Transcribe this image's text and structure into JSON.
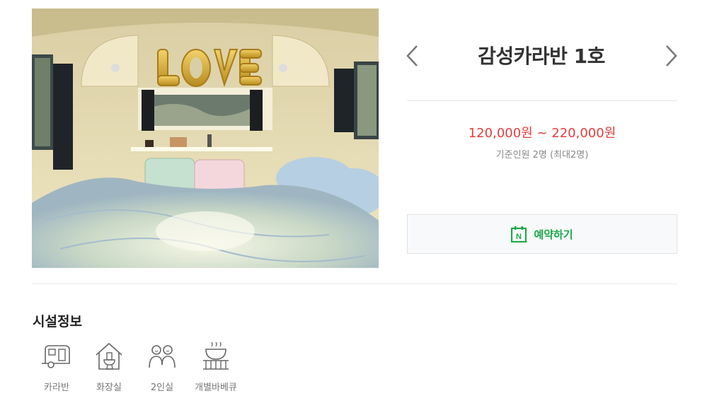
{
  "room": {
    "title": "감성카라반 1호",
    "photo_alt": "감성카라반 1호",
    "price": "120,000원 ~ 220,000원",
    "capacity": "기준인원 2명 (최대2명)"
  },
  "navigation": {
    "prev_icon": "chevron-left-icon",
    "next_icon": "chevron-right-icon"
  },
  "booking": {
    "label": "예약하기",
    "icon": "naver-calendar-icon",
    "icon_letter": "N",
    "color": "#1aa84a"
  },
  "facilities": {
    "title": "시설정보",
    "items": [
      {
        "label": "카라반",
        "icon": "caravan-icon"
      },
      {
        "label": "화장실",
        "icon": "toilet-icon"
      },
      {
        "label": "2인실",
        "icon": "two-person-icon"
      },
      {
        "label": "개별바베큐",
        "icon": "bbq-grill-icon"
      }
    ]
  },
  "colors": {
    "price": "#e53c3c",
    "accent_green": "#1aa84a",
    "title": "#333333"
  }
}
